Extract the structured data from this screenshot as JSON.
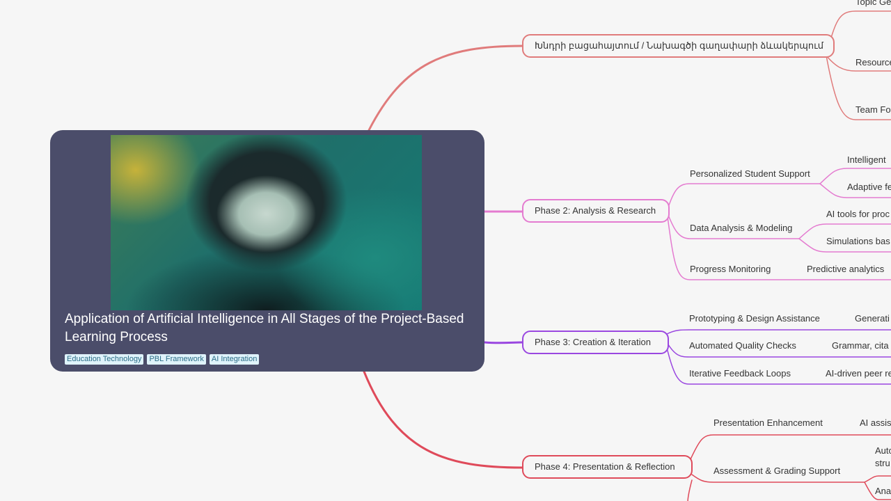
{
  "root": {
    "title": "Application of Artificial Intelligence in All Stages of the Project-Based Learning Process",
    "tags": [
      "Education Technology",
      "PBL Framework",
      "AI Integration"
    ]
  },
  "branches": [
    {
      "label": "Խնդրի բացահայտում / Նախագծի գաղափարի ձևակերպում",
      "color": "#e07b7b",
      "children": [
        {
          "label": "Topic Ge"
        },
        {
          "label": "Resource"
        },
        {
          "label": "Team Fo"
        }
      ]
    },
    {
      "label": "Phase 2: Analysis & Research",
      "color": "#e47bd0",
      "children": [
        {
          "label": "Personalized Student Support",
          "children": [
            "Intelligent",
            "Adaptive fe"
          ]
        },
        {
          "label": "Data Analysis & Modeling",
          "children": [
            "AI tools for proc",
            "Simulations bas"
          ]
        },
        {
          "label": "Progress Monitoring",
          "children": [
            "Predictive analytics"
          ]
        }
      ]
    },
    {
      "label": "Phase 3: Creation & Iteration",
      "color": "#9a47e0",
      "children": [
        {
          "label": "Prototyping & Design Assistance",
          "children": [
            "Generati"
          ]
        },
        {
          "label": "Automated Quality Checks",
          "children": [
            "Grammar, cita"
          ]
        },
        {
          "label": "Iterative Feedback Loops",
          "children": [
            "AI-driven peer re"
          ]
        }
      ]
    },
    {
      "label": "Phase 4: Presentation & Reflection",
      "color": "#df4a5a",
      "children": [
        {
          "label": "Presentation Enhancement",
          "children": [
            "AI assist"
          ]
        },
        {
          "label": "Assessment & Grading Support",
          "children": [
            "Auto\nstru",
            "Ana"
          ]
        }
      ]
    }
  ]
}
